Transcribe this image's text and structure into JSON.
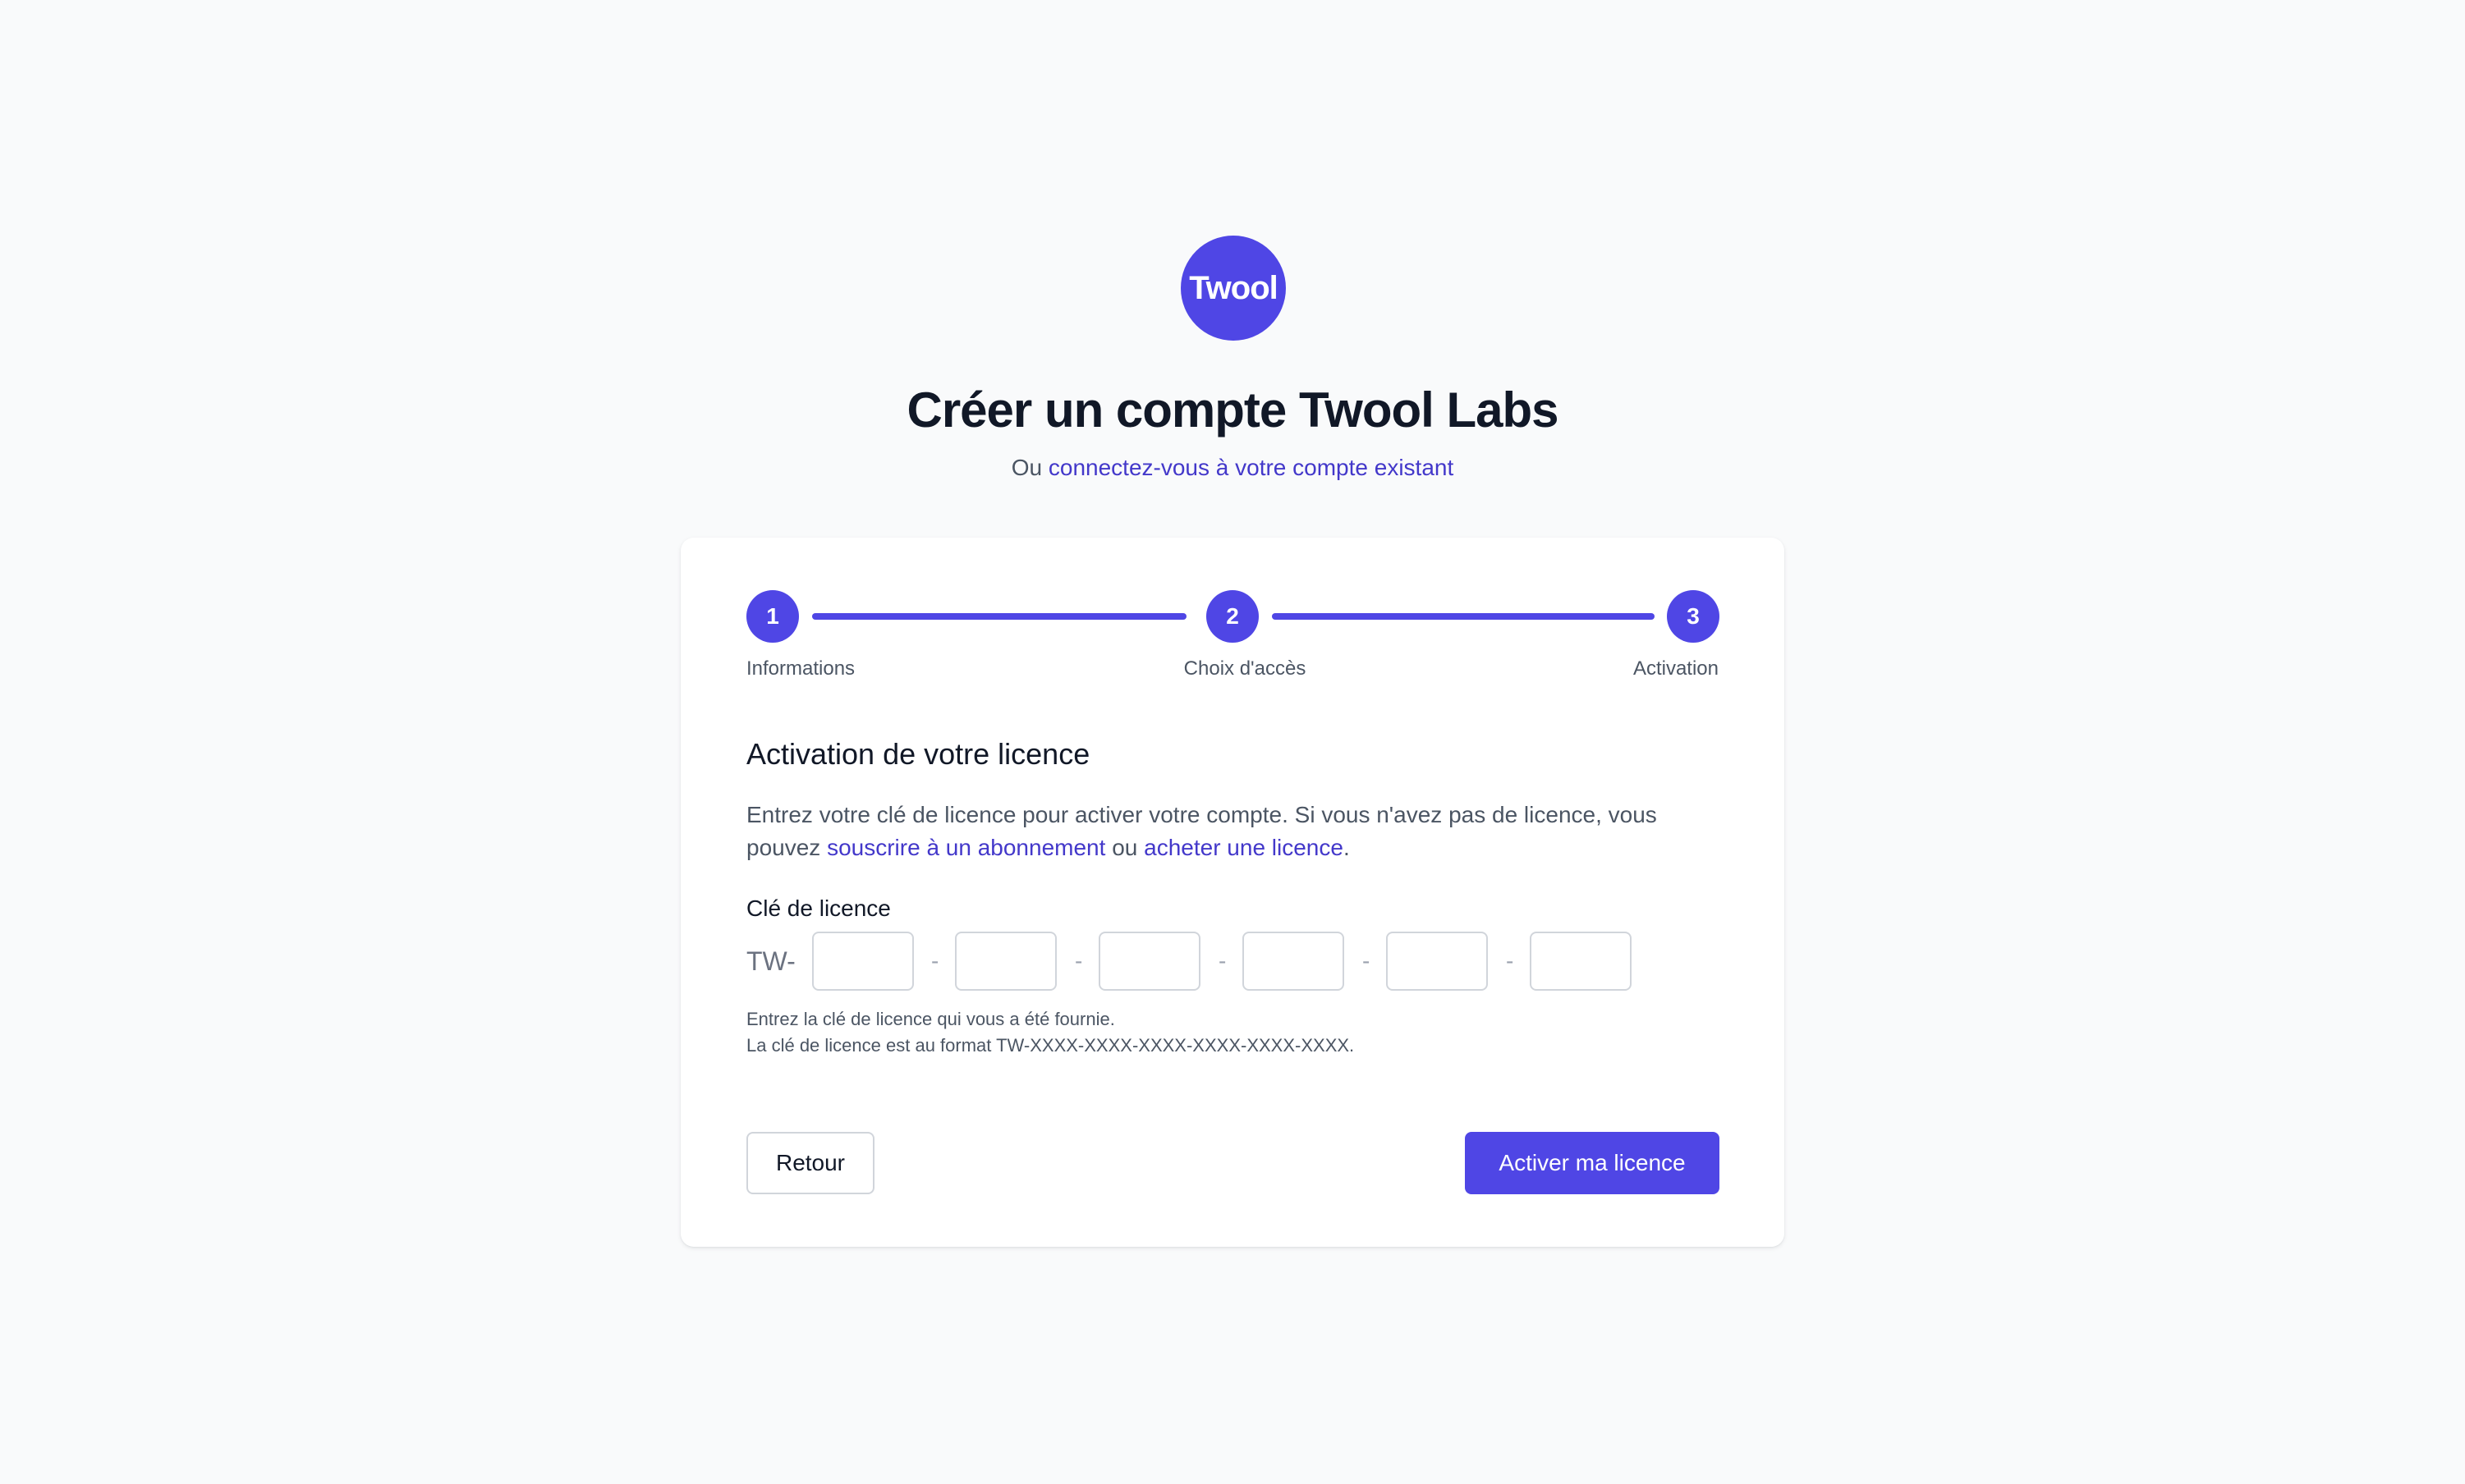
{
  "brand": {
    "logo_text": "Twool",
    "accent_color": "#4f46e5"
  },
  "header": {
    "title": "Créer un compte Twool Labs",
    "subtitle_prefix": "Ou",
    "login_link": "connectez-vous à votre compte existant"
  },
  "stepper": {
    "steps": [
      {
        "number": "1",
        "label": "Informations",
        "status": "complete"
      },
      {
        "number": "2",
        "label": "Choix d'accès",
        "status": "complete"
      },
      {
        "number": "3",
        "label": "Activation",
        "status": "current"
      }
    ]
  },
  "form": {
    "section_title": "Activation de votre licence",
    "description": {
      "text_before": "Entrez votre clé de licence pour activer votre compte. Si vous n'avez pas de licence, vous pouvez",
      "subscribe_link": "souscrire à un abonnement",
      "text_middle": "ou",
      "buy_link": "acheter une licence",
      "text_after": "."
    },
    "license_label": "Clé de licence",
    "key_prefix": "TW-",
    "separator": "-",
    "segments": [
      {
        "value": "",
        "placeholder": ""
      },
      {
        "value": "",
        "placeholder": ""
      },
      {
        "value": "",
        "placeholder": ""
      },
      {
        "value": "",
        "placeholder": ""
      },
      {
        "value": "",
        "placeholder": ""
      },
      {
        "value": "",
        "placeholder": ""
      }
    ],
    "help_line_1": "Entrez la clé de licence qui vous a été fournie.",
    "help_line_2": "La clé de licence est au format TW-XXXX-XXXX-XXXX-XXXX-XXXX-XXXX."
  },
  "actions": {
    "back_label": "Retour",
    "submit_label": "Activer ma licence"
  }
}
